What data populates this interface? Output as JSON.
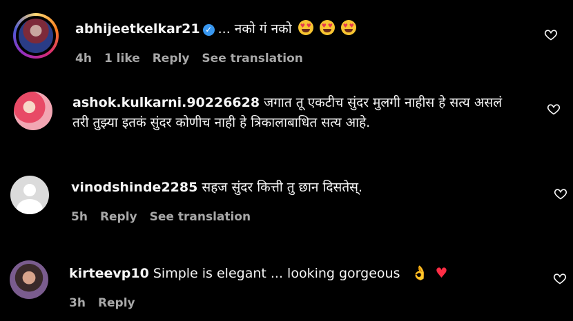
{
  "comments": [
    {
      "username": "abhijeetkelkar21",
      "verified": true,
      "text": "... नको गं नको",
      "emoji": [
        "smiling-face-with-heart-eyes",
        "smiling-face-with-heart-eyes",
        "smiling-face-with-heart-eyes"
      ],
      "time": "4h",
      "likes": "1 like",
      "reply": "Reply",
      "translation": "See translation"
    },
    {
      "username": "ashok.kulkarni.90226628",
      "text": "जगात तू एकटीच सुंदर मुलगी नाहीस हे सत्य असलं तरी तुझ्या इतकं सुंदर कोणीच नाही हे त्रिकालाबाधित सत्य आहे."
    },
    {
      "username": "vinodshinde2285",
      "text": "सहज सुंदर कित्ती तु छान दिसतेस्.",
      "time": "5h",
      "reply": "Reply",
      "translation": "See translation"
    },
    {
      "username": "kirteevp10",
      "text": "Simple is elegant ... looking gorgeous",
      "emoji": [
        "ok-hand",
        "red-heart"
      ],
      "time": "3h",
      "reply": "Reply"
    }
  ],
  "icons": {
    "like": "heart-outline-icon",
    "verified": "verified-badge-icon"
  },
  "colors": {
    "background": "#000000",
    "text": "#f5f5f5",
    "meta": "#a8a8a8",
    "verified": "#3897f0"
  }
}
